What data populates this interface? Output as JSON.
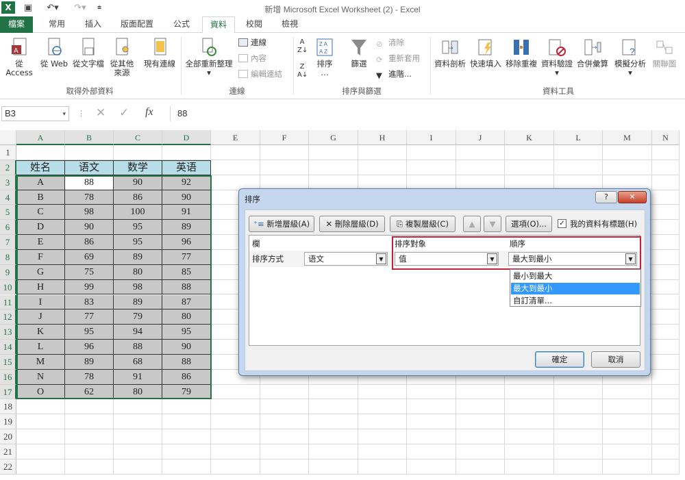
{
  "window": {
    "title": "新增 Microsoft Excel Worksheet (2) - Excel"
  },
  "tabs": [
    "檔案",
    "常用",
    "插入",
    "版面配置",
    "公式",
    "資料",
    "校閱",
    "檢視"
  ],
  "active_tab": "資料",
  "ribbon": {
    "get_external": {
      "label": "取得外部資料",
      "access": "從 Access",
      "web": "從 Web",
      "text": "從文字檔",
      "other1": "從其他",
      "other2": "來源"
    },
    "existing": "現有連線",
    "connections": {
      "label": "連線",
      "refresh1": "全部重新整理",
      "conn": "連線",
      "props": "內容",
      "edit": "編輯連結"
    },
    "sort_filter": {
      "label": "排序與篩選",
      "sort": "排序",
      "filter": "篩選",
      "clear": "清除",
      "reapply": "重新套用",
      "advanced": "進階..."
    },
    "tools": {
      "label": "資料工具",
      "text_to_cols": "資料剖析",
      "flash": "快速填入",
      "remove_dup": "移除重複",
      "validation": "資料驗證",
      "consolidate": "合併彙算",
      "whatif": "模擬分析",
      "relations": "關聯圖"
    }
  },
  "formula_bar": {
    "name_box": "B3",
    "value": "88",
    "fx": "fx"
  },
  "columns": [
    "A",
    "B",
    "C",
    "D",
    "E",
    "F",
    "G",
    "H",
    "I",
    "J",
    "K",
    "L",
    "M",
    "N"
  ],
  "rows": [
    "1",
    "2",
    "3",
    "4",
    "5",
    "6",
    "7",
    "8",
    "9",
    "10",
    "11",
    "12",
    "13",
    "14",
    "15",
    "16",
    "17",
    "18",
    "19",
    "20",
    "21",
    "22"
  ],
  "table": {
    "headers": [
      "姓名",
      "语文",
      "数学",
      "英语"
    ],
    "data": [
      [
        "A",
        "88",
        "90",
        "92"
      ],
      [
        "B",
        "78",
        "86",
        "90"
      ],
      [
        "C",
        "98",
        "100",
        "91"
      ],
      [
        "D",
        "90",
        "95",
        "89"
      ],
      [
        "E",
        "86",
        "95",
        "96"
      ],
      [
        "F",
        "69",
        "89",
        "77"
      ],
      [
        "G",
        "75",
        "80",
        "85"
      ],
      [
        "H",
        "99",
        "98",
        "88"
      ],
      [
        "I",
        "83",
        "89",
        "87"
      ],
      [
        "J",
        "77",
        "79",
        "80"
      ],
      [
        "K",
        "95",
        "94",
        "95"
      ],
      [
        "L",
        "96",
        "88",
        "90"
      ],
      [
        "M",
        "89",
        "68",
        "88"
      ],
      [
        "N",
        "78",
        "91",
        "86"
      ],
      [
        "O",
        "62",
        "80",
        "79"
      ]
    ]
  },
  "dialog": {
    "title": "排序",
    "help": "?",
    "add_level": "新增層級(A)",
    "delete_level": "刪除層級(D)",
    "copy_level": "複製層級(C)",
    "options": "選項(O)...",
    "has_headers": "我的資料有標題(H)",
    "col_header": "欄",
    "sort_on_header": "排序對象",
    "order_header": "順序",
    "sort_by": "排序方式",
    "column_value": "语文",
    "sort_on_value": "值",
    "order_value": "最大到最小",
    "order_options": [
      "最小到最大",
      "最大到最小",
      "自訂清單..."
    ],
    "ok": "確定",
    "cancel": "取消"
  },
  "colors": {
    "excel_green": "#217346",
    "header_fill": "#b7dde8",
    "data_fill": "#c8c8c8",
    "highlight_red": "#c0203a",
    "selection_blue": "#3399ff"
  }
}
